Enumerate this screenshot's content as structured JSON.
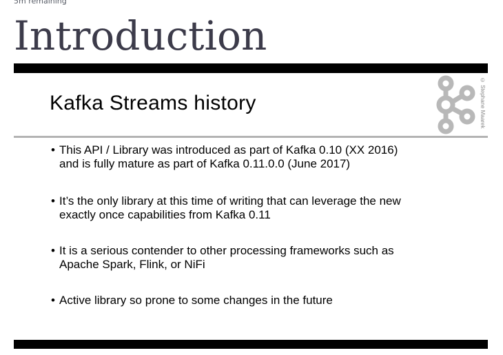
{
  "header": {
    "time_remaining": "5m remaining",
    "lecture_title": "Introduction"
  },
  "slide": {
    "heading": "Kafka Streams history",
    "copyright": "© Stephane Maarek",
    "logo_icon": "kafka-logo-icon",
    "bullets": [
      {
        "line1": "This API / Library was introduced as part of Kafka 0.10 (XX 2016)",
        "line2": "and is fully mature as part of Kafka 0.11.0.0 (June 2017)"
      },
      {
        "line1": "It’s the only library at this time of writing that can leverage the new",
        "line2": "exactly once capabilities from Kafka 0.11"
      },
      {
        "line1": "It is a serious contender to other processing frameworks such as",
        "line2": "Apache Spark, Flink, or NiFi"
      },
      {
        "line1": "Active library so prone to some changes in the future",
        "line2": ""
      }
    ]
  },
  "colors": {
    "title": "#3c3b4a",
    "slide_bar": "#000000",
    "divider": "#b3b3b3",
    "logo": "#b8b8b8"
  }
}
